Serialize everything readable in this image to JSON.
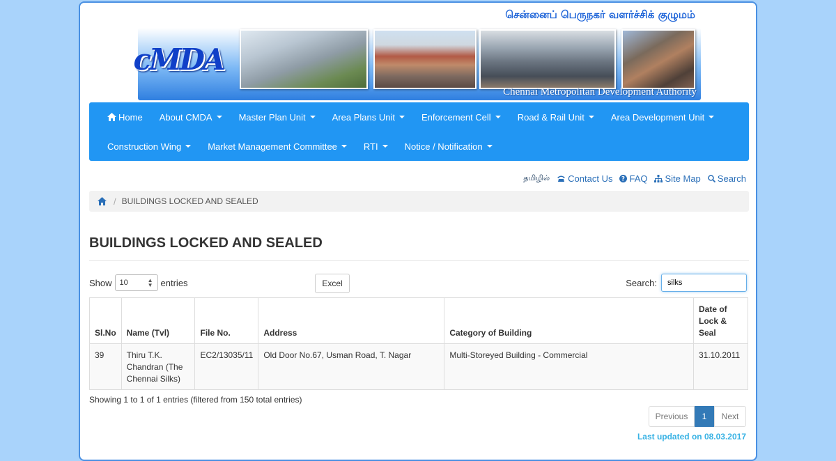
{
  "banner": {
    "tamil_title": "சென்னைப் பெருநகர் வளர்ச்சிக் குழுமம்",
    "logo_text": "cMDA",
    "english_title": "Chennai Metropolitan Development Authority"
  },
  "nav": {
    "row1": [
      {
        "label": "Home",
        "icon": "home-icon",
        "dropdown": false
      },
      {
        "label": "About CMDA",
        "dropdown": true
      },
      {
        "label": "Master Plan Unit",
        "dropdown": true
      },
      {
        "label": "Area Plans Unit",
        "dropdown": true
      },
      {
        "label": "Enforcement Cell",
        "dropdown": true
      },
      {
        "label": "Road & Rail Unit",
        "dropdown": true
      },
      {
        "label": "Area Development Unit",
        "dropdown": true
      }
    ],
    "row2": [
      {
        "label": "Construction Wing",
        "dropdown": true
      },
      {
        "label": "Market Management Committee",
        "dropdown": true
      },
      {
        "label": "RTI",
        "dropdown": true
      },
      {
        "label": "Notice / Notification",
        "dropdown": true
      }
    ]
  },
  "utility": {
    "tamil": "தமிழில்",
    "contact": "Contact Us",
    "faq": "FAQ",
    "sitemap": "Site Map",
    "search": "Search"
  },
  "breadcrumb": {
    "current": "BUILDINGS LOCKED AND SEALED"
  },
  "page_title": "BUILDINGS LOCKED AND SEALED",
  "controls": {
    "show_label": "Show",
    "entries_value": "10",
    "entries_label": "entries",
    "excel_label": "Excel",
    "search_label": "Search:",
    "search_value": "silks"
  },
  "table": {
    "headers": [
      "Sl.No",
      "Name (Tvl)",
      "File No.",
      "Address",
      "Category of Building",
      "Date of Lock & Seal"
    ],
    "rows": [
      [
        "39",
        "Thiru T.K. Chandran (The Chennai Silks)",
        "EC2/13035/11",
        "Old Door No.67, Usman Road, T. Nagar",
        "Multi-Storeyed Building - Commercial",
        "31.10.2011"
      ]
    ]
  },
  "info_text": "Showing 1 to 1 of 1 entries (filtered from 150 total entries)",
  "pagination": {
    "previous": "Previous",
    "current": "1",
    "next": "Next"
  },
  "last_updated": "Last updated on 08.03.2017",
  "colors": {
    "background": "#a9d3fb",
    "navbar": "#2196f3",
    "link": "#2a6fb8",
    "pager_active": "#337ab7",
    "updated_text": "#38b2e4"
  }
}
